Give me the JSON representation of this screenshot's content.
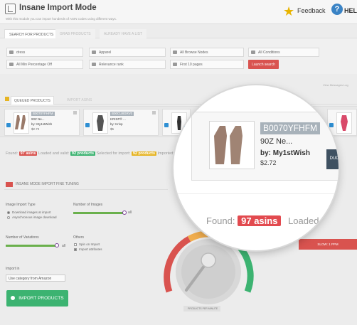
{
  "header": {
    "title": "Insane Import Mode",
    "subtitle": "With this module you can import hundreds of ASIN codes using different ways.",
    "feedback_label": "Feedback",
    "help_label": "HELP",
    "help_glyph": "?"
  },
  "search_tabs": [
    "SEARCH FOR PRODUCTS",
    "GRAB PRODUCTS",
    "ALREADY HAVE A LIST"
  ],
  "filters": {
    "keyword": "dress",
    "category": "Apparel",
    "browse_nodes": "All Browse Nodes",
    "condition": "All Conditions",
    "min_percentage": "All Min Percentage Off",
    "sort": "Relevance rank",
    "pages": "First 10 pages",
    "launch_label": "Launch search"
  },
  "view_messages_label": "View Messages Log",
  "queue_tabs": [
    "QUEUED PRODUCTS",
    "IMPORT ASINS"
  ],
  "products": [
    {
      "asin": "B0070YFHFM",
      "name": "90Z Ne...",
      "by": "by: My1stWish",
      "price": "$2.72"
    },
    {
      "asin": "B00CU8GRV0",
      "name": "KRISP® ...",
      "by": "by: Krisp",
      "price": "$5"
    },
    {
      "asin": "",
      "name": "",
      "by": "",
      "price": ""
    },
    {
      "asin": "",
      "name": "",
      "by": "",
      "price": ""
    }
  ],
  "found": {
    "prefix": "Found:",
    "count": "97",
    "unit": "asins",
    "loaded_prefix": "Loaded and valid:",
    "loaded_count": "92",
    "loaded_unit": "products",
    "selected_prefix": "Selected for import:",
    "selected_count": "92",
    "selected_unit": "products",
    "imported_prefix": "Imported:"
  },
  "fine_tuning": {
    "title": "INSANE MODE IMPORT FINE TUNING",
    "image_import_type_label": "Image Import Type",
    "image_import_options": [
      "Download images at import",
      "Asynchronous image download"
    ],
    "number_of_images_label": "Number of Images",
    "number_of_images_value": "all",
    "number_of_images_fill": 1.0,
    "number_of_variations_label": "Number of Variations",
    "number_of_variations_value": "all",
    "number_of_variations_fill": 1.0,
    "others_label": "Others",
    "others_options": [
      "Spin on Import",
      "Import attributes"
    ],
    "import_in_label": "Import in",
    "import_in_value": "Use category from Amazon",
    "import_button_label": "IMPORT PRODUCTS"
  },
  "speed": {
    "badge": "SLOW: 1 PPM",
    "results_label": "PRODUCTS PER MINUTE"
  },
  "magnifier": {
    "asin": "B0070YFHFM",
    "name": "90Z Ne...",
    "by": "by: My1stWish",
    "price": "$2.72",
    "found_prefix": "Found:",
    "found_count": "97",
    "found_unit": "asins",
    "loaded_text": "Loaded and vali",
    "products_button": "DUCTS"
  },
  "colors": {
    "accent_red": "#d9534f",
    "accent_green": "#3cb371",
    "checkbox_blue": "#2e8fd3",
    "pill_yellow": "#e6b422"
  }
}
